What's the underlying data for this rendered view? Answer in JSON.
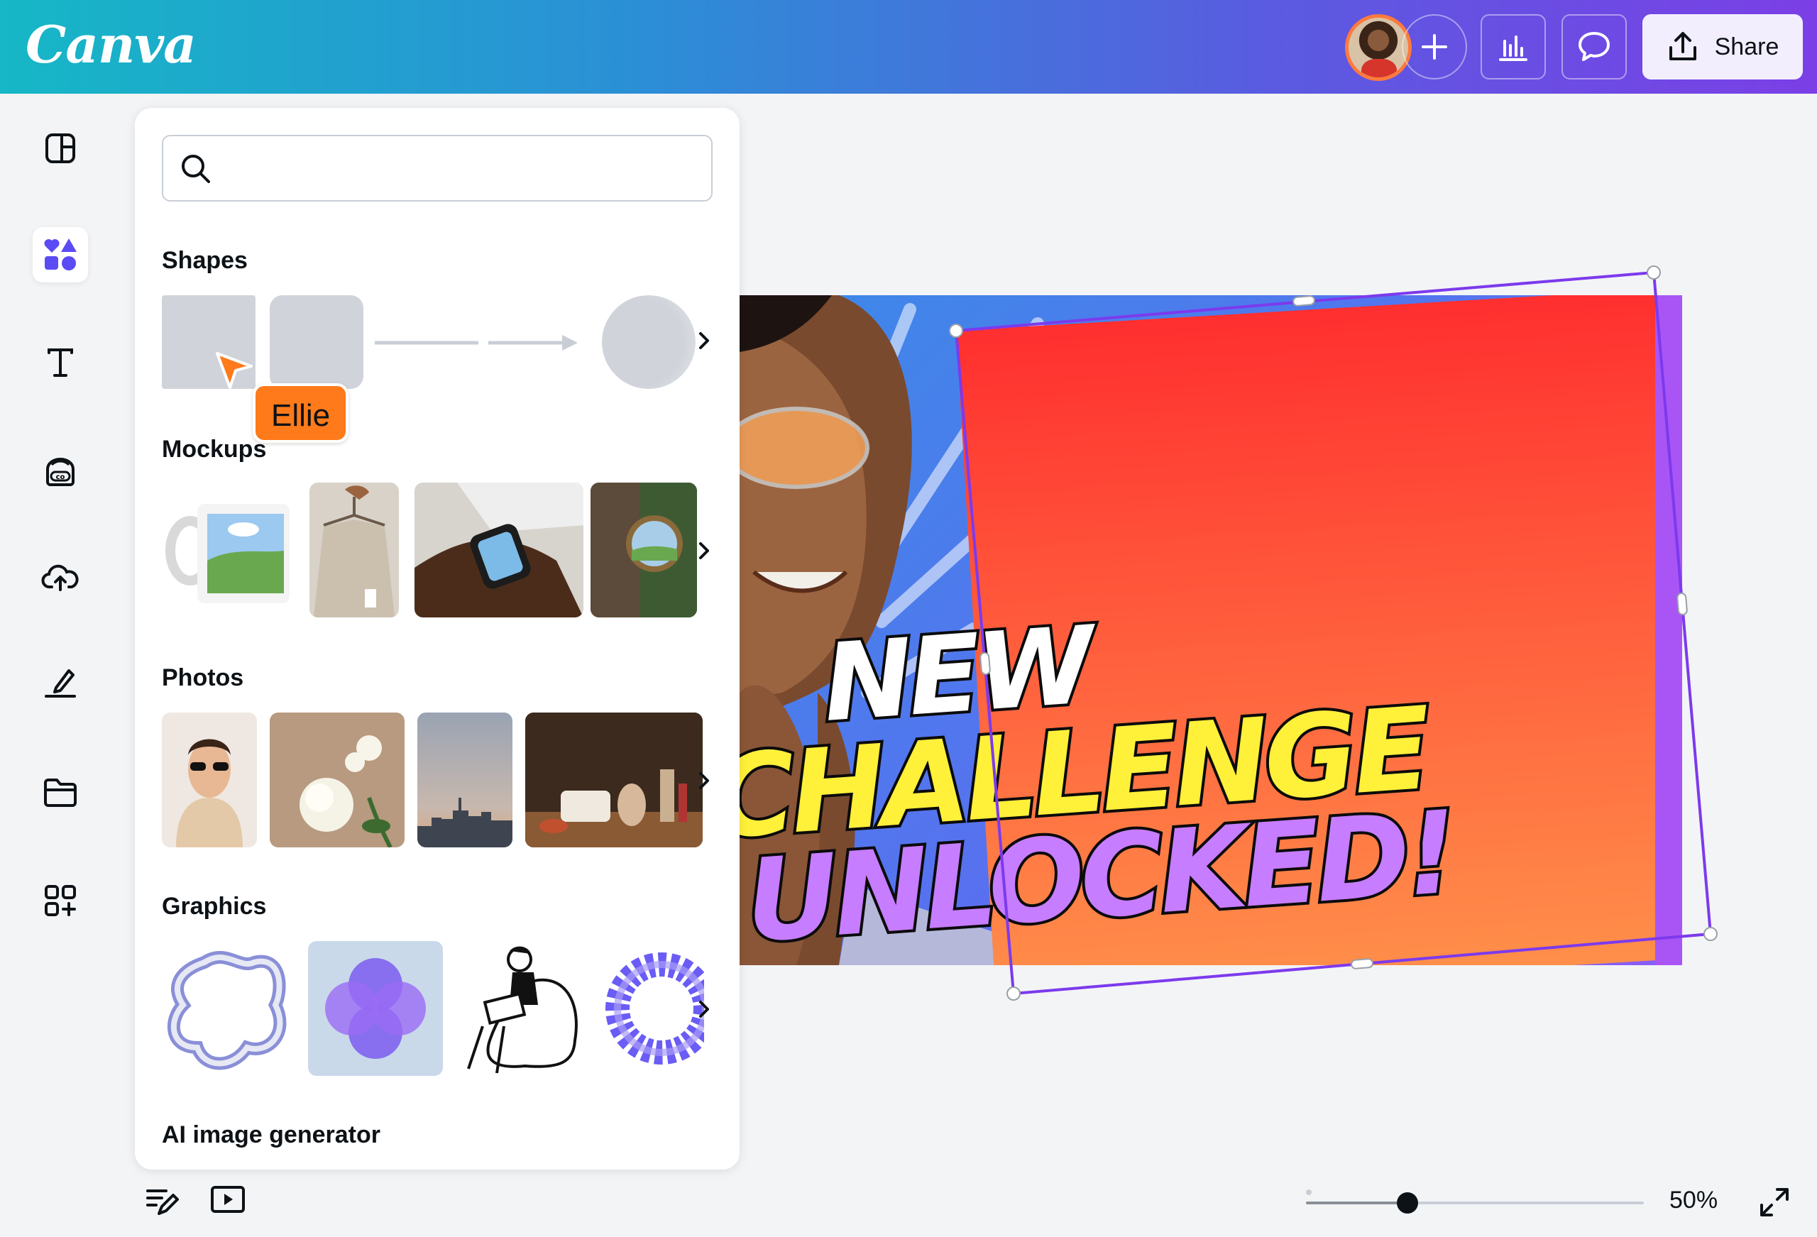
{
  "app": {
    "logo_text": "Canva"
  },
  "topbar": {
    "share_label": "Share",
    "buttons": [
      "plus-icon",
      "chart-icon",
      "comment-icon",
      "upload-icon"
    ]
  },
  "rail": {
    "items": [
      "layout-icon",
      "elements-icon",
      "text-icon",
      "brand-icon",
      "uploads-icon",
      "draw-icon",
      "projects-icon",
      "apps-icon"
    ],
    "active": "elements-icon"
  },
  "panel": {
    "search": {
      "value": "",
      "placeholder": ""
    },
    "sections": {
      "shapes": "Shapes",
      "mockups": "Mockups",
      "photos": "Photos",
      "graphics": "Graphics",
      "ai": "AI image generator"
    },
    "collaborator_cursor": {
      "name": "Ellie",
      "color": "#ff7a1a"
    }
  },
  "canvas": {
    "headline": {
      "line1": "NEW",
      "line2": "CHALLENGE",
      "line3": "UNLOCKED!"
    },
    "colors": {
      "line1": "#ffffff",
      "line2": "#fff03a",
      "line3": "#c77dff",
      "selection": "#7c3aed"
    }
  },
  "bottombar": {
    "zoom_label": "50%",
    "zoom_level_percent": 50
  },
  "colors": {
    "accent": "#7d2ae8",
    "brand_start": "#16b7c6",
    "brand_end": "#7b3fe6"
  }
}
